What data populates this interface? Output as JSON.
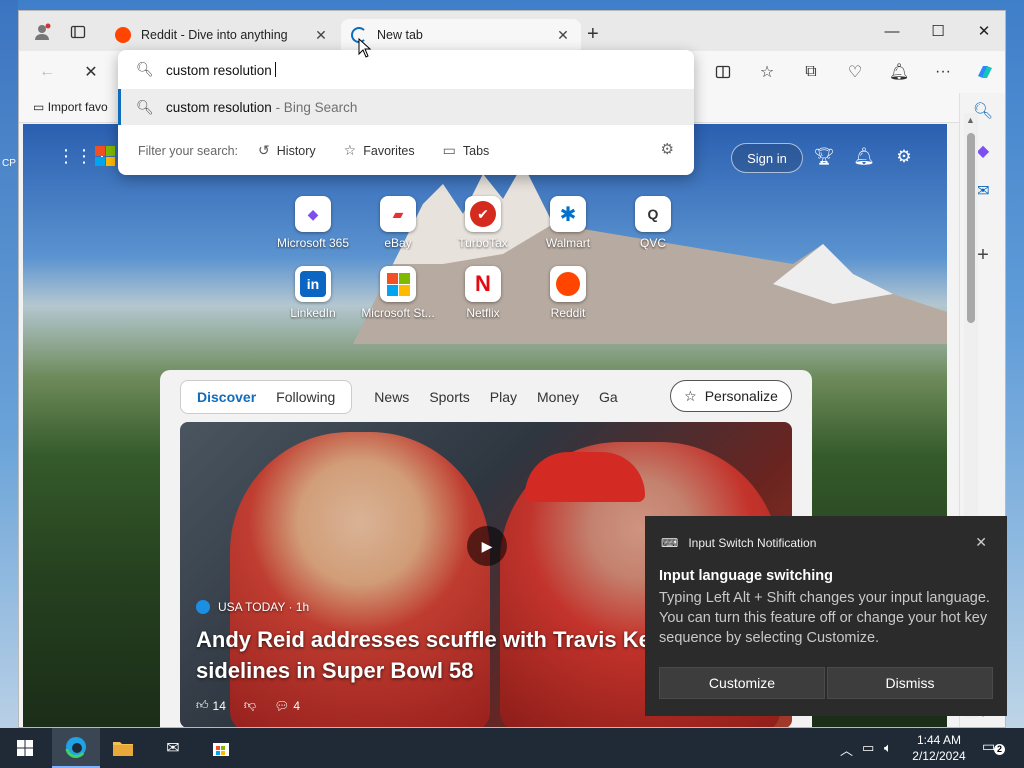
{
  "browser": {
    "tabs": [
      {
        "title": "Reddit - Dive into anything",
        "active": false,
        "favicon_color": "#ff4500"
      },
      {
        "title": "New tab",
        "active": true,
        "favicon_color": "#0f6cbd"
      }
    ],
    "favorites_bar": {
      "import_label": "Import favo"
    }
  },
  "address_dropdown": {
    "query": "custom resolution",
    "suggestion": {
      "text": "custom resolution",
      "hint": " - Bing Search"
    },
    "filter_label": "Filter your search:",
    "filters": [
      {
        "label": "History",
        "icon": "history-icon"
      },
      {
        "label": "Favorites",
        "icon": "star-icon"
      },
      {
        "label": "Tabs",
        "icon": "tabs-icon"
      }
    ]
  },
  "newtab": {
    "signin_label": "Sign in",
    "quick_links": [
      {
        "label": "Microsoft 365",
        "glyph": "◆",
        "color": "#7b4ff0"
      },
      {
        "label": "eBay",
        "glyph": "▰",
        "color": "#e53238"
      },
      {
        "label": "TurboTax",
        "glyph": "✔",
        "color": "#d52b1e"
      },
      {
        "label": "Walmart",
        "glyph": "✱",
        "color": "#0071ce"
      },
      {
        "label": "QVC",
        "glyph": "Q",
        "color": "#333333"
      },
      {
        "label": "LinkedIn",
        "glyph": "in",
        "color": "#0a66c2"
      },
      {
        "label": "Microsoft St...",
        "glyph": "▦",
        "color": "#f25022"
      },
      {
        "label": "Netflix",
        "glyph": "N",
        "color": "#e50914"
      },
      {
        "label": "Reddit",
        "glyph": "●",
        "color": "#ff4500"
      }
    ],
    "feed": {
      "tabs": [
        "Discover",
        "Following"
      ],
      "sections": [
        "News",
        "Sports",
        "Play",
        "Money",
        "Ga"
      ],
      "personalize_label": "Personalize",
      "hero": {
        "source": "USA TODAY · 1h",
        "headline_line1": "Andy Reid addresses scuffle with Travis Ke",
        "headline_line2": "sidelines in Super Bowl 58",
        "likes": "14",
        "comments": "4"
      }
    }
  },
  "notification": {
    "app": "Input Switch Notification",
    "title": "Input language switching",
    "body": "Typing Left Alt + Shift changes your input language. You can turn this feature off or change your hot key sequence by selecting Customize.",
    "buttons": [
      "Customize",
      "Dismiss"
    ]
  },
  "taskbar": {
    "time": "1:44 AM",
    "date": "2/12/2024",
    "notification_count": "2"
  }
}
